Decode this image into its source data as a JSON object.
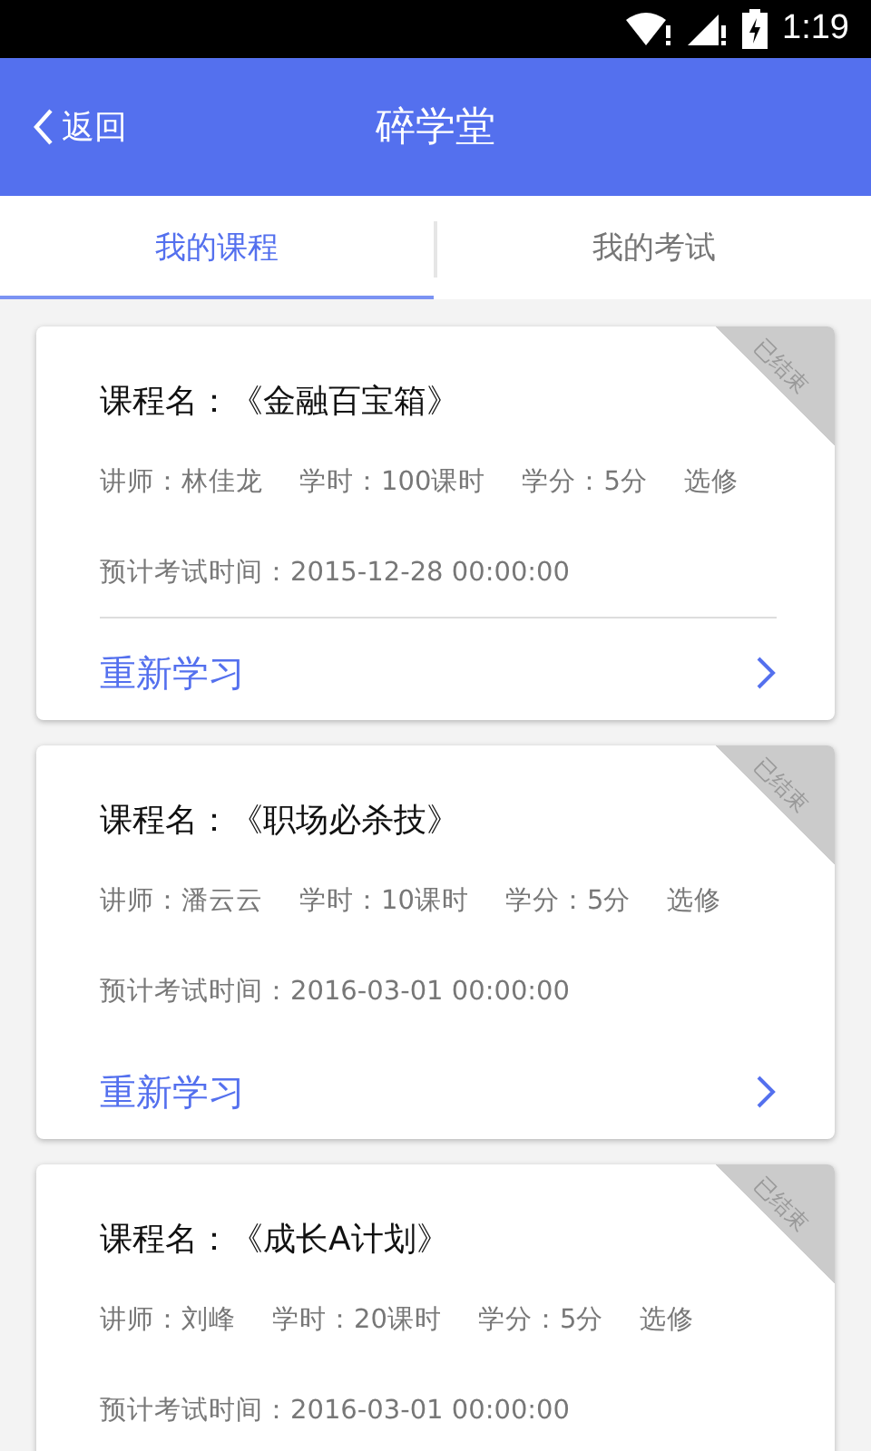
{
  "status_bar": {
    "time": "1:19"
  },
  "header": {
    "back": "返回",
    "title": "碎学堂"
  },
  "tabs": [
    {
      "label": "我的课程",
      "selected": true
    },
    {
      "label": "我的考试",
      "selected": false
    }
  ],
  "courses": [
    {
      "title": "课程名：《金融百宝箱》",
      "teacher": "讲师：林佳龙",
      "hours": "学时：100课时",
      "credits": "学分：5分",
      "type": "选修",
      "exam_time": "预计考试时间：2015-12-28 00:00:00",
      "status": "已结束",
      "divider": true,
      "action": "重新学习"
    },
    {
      "title": "课程名：《职场必杀技》",
      "teacher": "讲师：潘云云",
      "hours": "学时：10课时",
      "credits": "学分：5分",
      "type": "选修",
      "exam_time": "预计考试时间：2016-03-01 00:00:00",
      "status": "已结束",
      "divider": false,
      "action": "重新学习"
    },
    {
      "title": "课程名：《成长A计划》",
      "teacher": "讲师：刘峰",
      "hours": "学时：20课时",
      "credits": "学分：5分",
      "type": "选修",
      "exam_time": "预计考试时间：2016-03-01 00:00:00",
      "status": "已结束"
    }
  ]
}
